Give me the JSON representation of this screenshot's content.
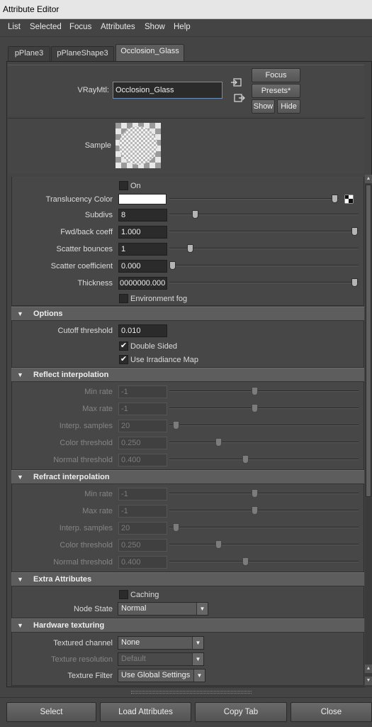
{
  "window": {
    "title": "Attribute Editor"
  },
  "menu": [
    "List",
    "Selected",
    "Focus",
    "Attributes",
    "Show",
    "Help"
  ],
  "tabs": [
    "pPlane3",
    "pPlaneShape3",
    "Occlosion_Glass"
  ],
  "header": {
    "node_type_label": "VRayMtl:",
    "node_name": "Occlosion_Glass",
    "focus": "Focus",
    "presets": "Presets*",
    "show": "Show",
    "hide": "Hide",
    "sample_label": "Sample"
  },
  "translucency": {
    "on_label": "On",
    "translucency_color_label": "Translucency Color",
    "translucency_color": "#ffffff",
    "subdivs": {
      "label": "Subdivs",
      "value": "8"
    },
    "fwd_back": {
      "label": "Fwd/back coeff",
      "value": "1.000"
    },
    "scatter_bounces": {
      "label": "Scatter bounces",
      "value": "1"
    },
    "scatter_coeff": {
      "label": "Scatter coefficient",
      "value": "0.000"
    },
    "thickness": {
      "label": "Thickness",
      "value": "0000000.000"
    },
    "env_fog_label": "Environment fog"
  },
  "options": {
    "title": "Options",
    "cutoff": {
      "label": "Cutoff threshold",
      "value": "0.010"
    },
    "double_sided": "Double Sided",
    "use_irradiance": "Use Irradiance Map"
  },
  "reflect": {
    "title": "Reflect interpolation",
    "min_rate": {
      "label": "Min rate",
      "value": "-1"
    },
    "max_rate": {
      "label": "Max rate",
      "value": "-1"
    },
    "interp": {
      "label": "Interp. samples",
      "value": "20"
    },
    "color_thr": {
      "label": "Color threshold",
      "value": "0.250"
    },
    "normal_thr": {
      "label": "Normal threshold",
      "value": "0.400"
    }
  },
  "refract": {
    "title": "Refract interpolation",
    "min_rate": {
      "label": "Min rate",
      "value": "-1"
    },
    "max_rate": {
      "label": "Max rate",
      "value": "-1"
    },
    "interp": {
      "label": "Interp. samples",
      "value": "20"
    },
    "color_thr": {
      "label": "Color threshold",
      "value": "0.250"
    },
    "normal_thr": {
      "label": "Normal threshold",
      "value": "0.400"
    }
  },
  "extra": {
    "title": "Extra Attributes",
    "caching": "Caching",
    "node_state_label": "Node State",
    "node_state": "Normal"
  },
  "hw": {
    "title": "Hardware texturing",
    "textured_channel_label": "Textured channel",
    "textured_channel": "None",
    "texture_resolution_label": "Texture resolution",
    "texture_resolution": "Default",
    "texture_filter_label": "Texture Filter",
    "texture_filter": "Use Global Settings"
  },
  "bottom": [
    "Select",
    "Load Attributes",
    "Copy Tab",
    "Close"
  ]
}
